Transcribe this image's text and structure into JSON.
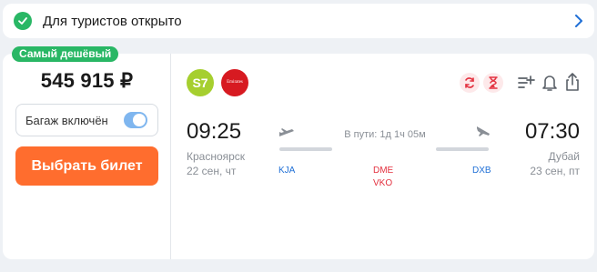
{
  "banner": {
    "text": "Для туристов открыто",
    "icon": "check-circle-icon",
    "chevron_icon": "chevron-right-icon"
  },
  "offer": {
    "badge": "Самый дешёвый",
    "price": "545 915 ₽",
    "baggage_label": "Багаж включён",
    "baggage_included": true,
    "select_button": "Выбрать билет"
  },
  "airlines": [
    {
      "name": "S7",
      "logo_text": "S7",
      "color": "#a6cf2f"
    },
    {
      "name": "Emirates",
      "logo_text": "Emirates",
      "color": "#d71a21"
    }
  ],
  "actions": {
    "icons": [
      "refresh-icon",
      "hourglass-icon",
      "playlist-add-icon",
      "bell-icon",
      "share-icon"
    ]
  },
  "flight": {
    "departure": {
      "time": "09:25",
      "city": "Красноярск",
      "date": "22 сен, чт",
      "code": "KJA"
    },
    "arrival": {
      "time": "07:30",
      "city": "Дубай",
      "date": "23 сен, пт",
      "code": "DXB"
    },
    "duration": "В пути: 1д 1ч 05м",
    "transfer_codes": [
      "DME",
      "VKO"
    ]
  },
  "colors": {
    "accent_green": "#29b765",
    "button_orange": "#ff6d2e",
    "link_blue": "#1f6fd6",
    "transfer_red": "#e3313f",
    "toggle_blue": "#7fb6ef"
  }
}
